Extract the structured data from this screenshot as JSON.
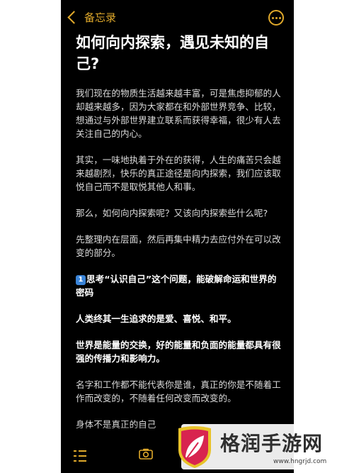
{
  "nav": {
    "back_label": "备忘录"
  },
  "note": {
    "title": "如何向内探索，遇见未知的自己?",
    "paragraphs": [
      {
        "text": "我们现在的物质生活越来越丰富，可是焦虑抑郁的人却越来越多，因为大家都在和外部世界竞争、比较，想通过与外部世界建立联系而获得幸福，很少有人去关注自己的内心。",
        "bold": false
      },
      {
        "text": "其实，一味地执着于外在的获得，人生的痛苦只会越来越剧烈，快乐的真正途径是向内探索，我们应该取悦自己而不是取悦其他人和事。",
        "bold": false
      },
      {
        "text": "那么，如何向内探索呢？又该向内探索些什么呢?",
        "bold": false
      },
      {
        "text": "先整理内在层面，然后再集中精力去应付外在可以改变的部分。",
        "bold": false
      },
      {
        "badge": "1",
        "text": "思考“认识自己”这个问题，能破解命运和世界的密码",
        "bold": true
      },
      {
        "text": "人类终其一生追求的是爱、喜悦、和平。",
        "bold": true
      },
      {
        "text": "世界是能量的交换，好的能量和负面的能量都具有很强的传播力和影响力。",
        "bold": true
      },
      {
        "text": "名字和工作都不能代表你是谁，真正的你是不随着工作而改变的，不随着任何改变而改变的。",
        "bold": false
      },
      {
        "text": "身体不是真正的自己",
        "bold": false
      }
    ]
  },
  "watermark": {
    "text": "格润手游网",
    "url": "www.hngrjd.com"
  },
  "colors": {
    "accent": "#e0a92b",
    "background": "#000000",
    "text": "#dcdcdc"
  },
  "icons": {
    "back": "chevron-left-icon",
    "more": "ellipsis-circle-icon",
    "checklist": "checklist-icon",
    "camera": "camera-icon"
  }
}
